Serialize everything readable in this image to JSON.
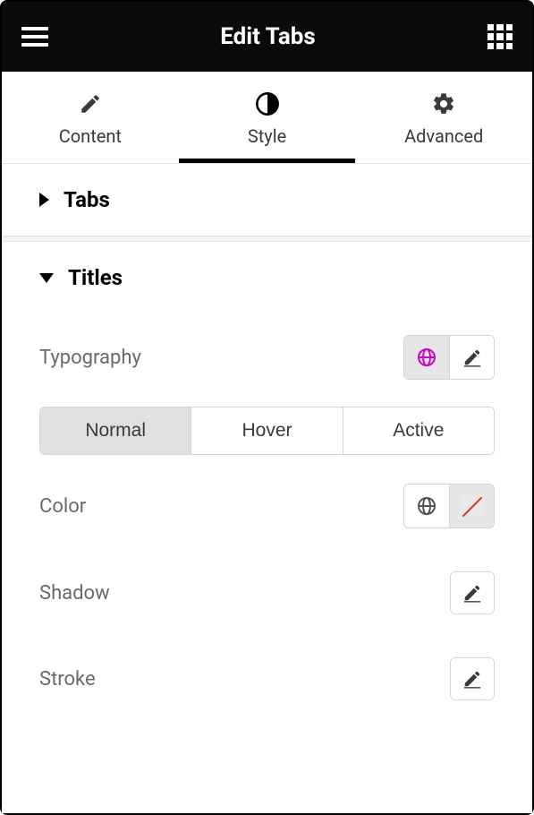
{
  "header": {
    "title": "Edit Tabs"
  },
  "tabs": [
    {
      "label": "Content",
      "icon": "pencil"
    },
    {
      "label": "Style",
      "icon": "contrast"
    },
    {
      "label": "Advanced",
      "icon": "gear"
    }
  ],
  "activeTab": 1,
  "sections": {
    "tabs": {
      "title": "Tabs",
      "expanded": false
    },
    "titles": {
      "title": "Titles",
      "expanded": true,
      "controls": {
        "typography": {
          "label": "Typography"
        },
        "states": [
          "Normal",
          "Hover",
          "Active"
        ],
        "activeState": 0,
        "color": {
          "label": "Color"
        },
        "shadow": {
          "label": "Shadow"
        },
        "stroke": {
          "label": "Stroke"
        }
      }
    }
  }
}
